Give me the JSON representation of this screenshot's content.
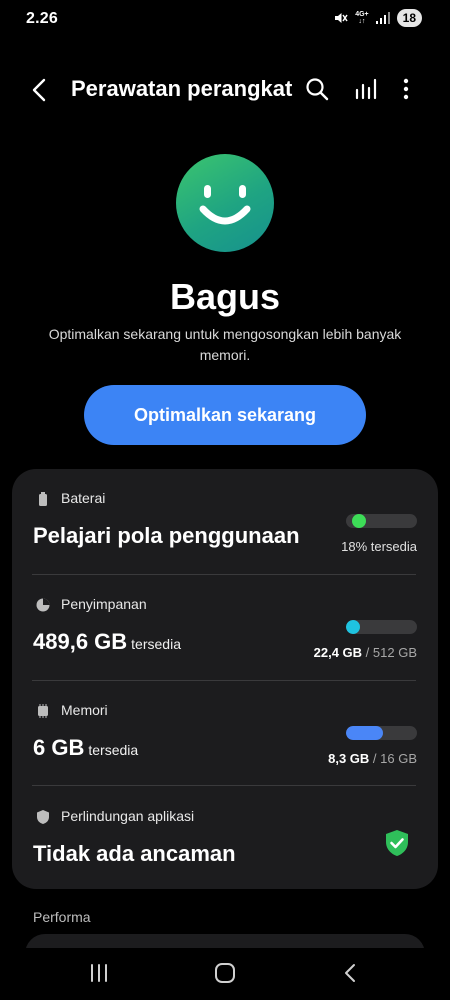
{
  "status_bar": {
    "time": "2.26",
    "network_top": "4G+",
    "network_bottom": "↓↑",
    "battery": "18",
    "icons": [
      "mute-icon",
      "signal-icon",
      "battery-icon"
    ]
  },
  "app_bar": {
    "title": "Perawatan perangkat",
    "icons": [
      "back-icon",
      "search-icon",
      "chart-icon",
      "more-icon"
    ]
  },
  "hero": {
    "status": "Bagus",
    "description": "Optimalkan sekarang untuk mengosongkan lebih banyak memori.",
    "button_label": "Optimalkan sekarang",
    "icon": "smiley-icon",
    "icon_color": "#22a57e"
  },
  "sections": {
    "battery": {
      "label": "Baterai",
      "value": "Pelajari pola penggunaan",
      "meta": "18% tersedia",
      "level": 0.18,
      "color": "#3ddc57",
      "icon": "battery-icon"
    },
    "storage": {
      "label": "Penyimpanan",
      "value": "489,6 GB",
      "unit": "tersedia",
      "used": "22,4 GB",
      "separator": " / ",
      "total": "512 GB",
      "level": 0.044,
      "color": "#1fc3e0",
      "icon": "pie-chart-icon"
    },
    "memory": {
      "label": "Memori",
      "value": "6 GB",
      "unit": "tersedia",
      "used": "8,3 GB",
      "separator": " / ",
      "total": "16 GB",
      "level": 0.52,
      "color": "#4a86f7",
      "icon": "memory-chip-icon"
    },
    "protection": {
      "label": "Perlindungan aplikasi",
      "value": "Tidak ada ancaman",
      "icon": "shield-icon",
      "status_icon": "shield-check-icon",
      "status_color": "#2fbf5a"
    }
  },
  "bottom": {
    "performance_label": "Performa"
  },
  "nav": {
    "buttons": [
      "recents-button",
      "home-button",
      "back-button"
    ]
  },
  "colors": {
    "background": "#000000",
    "card": "#1c1c1e",
    "accent": "#3c84f5"
  }
}
